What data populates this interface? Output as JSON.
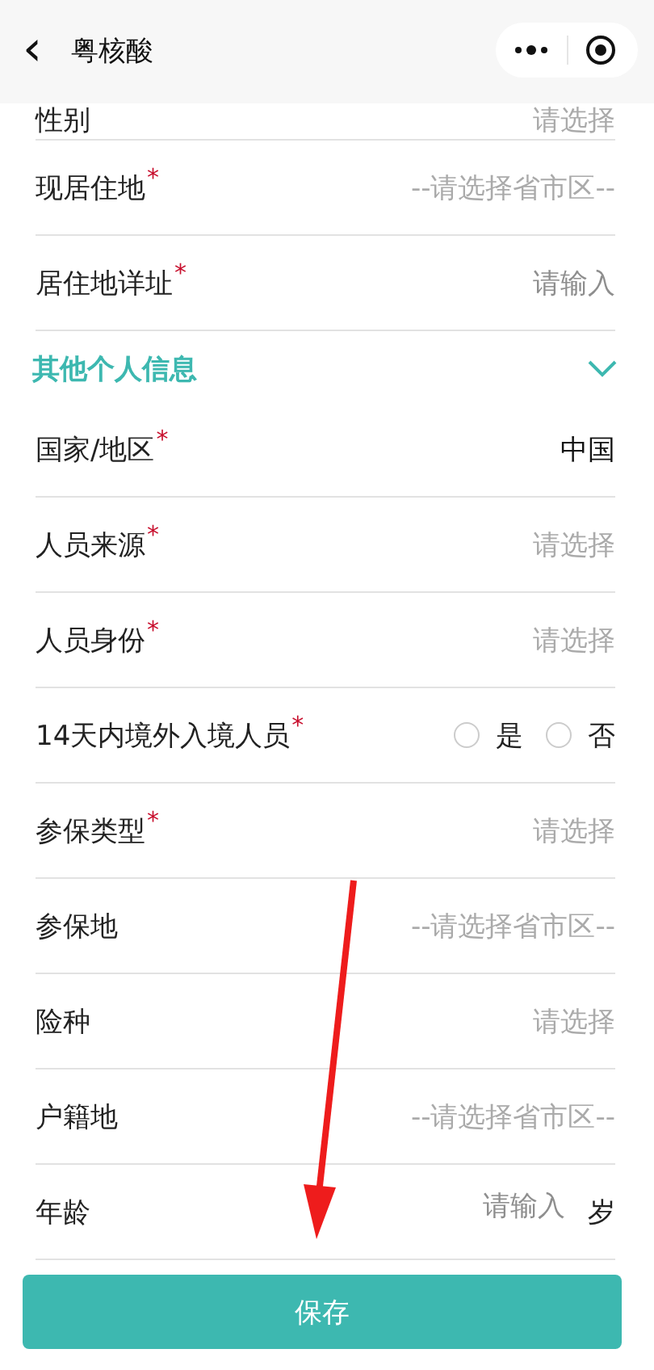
{
  "header": {
    "back_icon": "‹",
    "title": "粤核酸"
  },
  "rows_before": [
    {
      "kind": "select",
      "label": "性别",
      "placeholder": "请选择"
    },
    {
      "kind": "select",
      "label": "现居住地",
      "required_mark": "*",
      "placeholder": "--请选择省市区--"
    },
    {
      "kind": "input",
      "label": "居住地详址",
      "required_mark": "*",
      "placeholder": "请输入"
    }
  ],
  "section": {
    "title": "其他个人信息",
    "expanded": true
  },
  "rows": [
    {
      "kind": "value",
      "label": "国家/地区",
      "required_mark": "*",
      "value": "中国"
    },
    {
      "kind": "select",
      "label": "人员来源",
      "required_mark": "*",
      "placeholder": "请选择"
    },
    {
      "kind": "select",
      "label": "人员身份",
      "required_mark": "*",
      "placeholder": "请选择"
    },
    {
      "kind": "radio",
      "label": "14天内境外入境人员",
      "required_mark": "*",
      "options": [
        {
          "label": "是",
          "selected": false
        },
        {
          "label": "否",
          "selected": false
        }
      ]
    },
    {
      "kind": "select",
      "label": "参保类型",
      "required_mark": "*",
      "placeholder": "请选择"
    },
    {
      "kind": "select",
      "label": "参保地",
      "placeholder": "--请选择省市区--"
    },
    {
      "kind": "select",
      "label": "险种",
      "placeholder": "请选择"
    },
    {
      "kind": "select",
      "label": "户籍地",
      "placeholder": "--请选择省市区--"
    },
    {
      "kind": "input",
      "label": "年龄",
      "placeholder": "请输入",
      "unit": "岁"
    }
  ],
  "save_button": "保存"
}
